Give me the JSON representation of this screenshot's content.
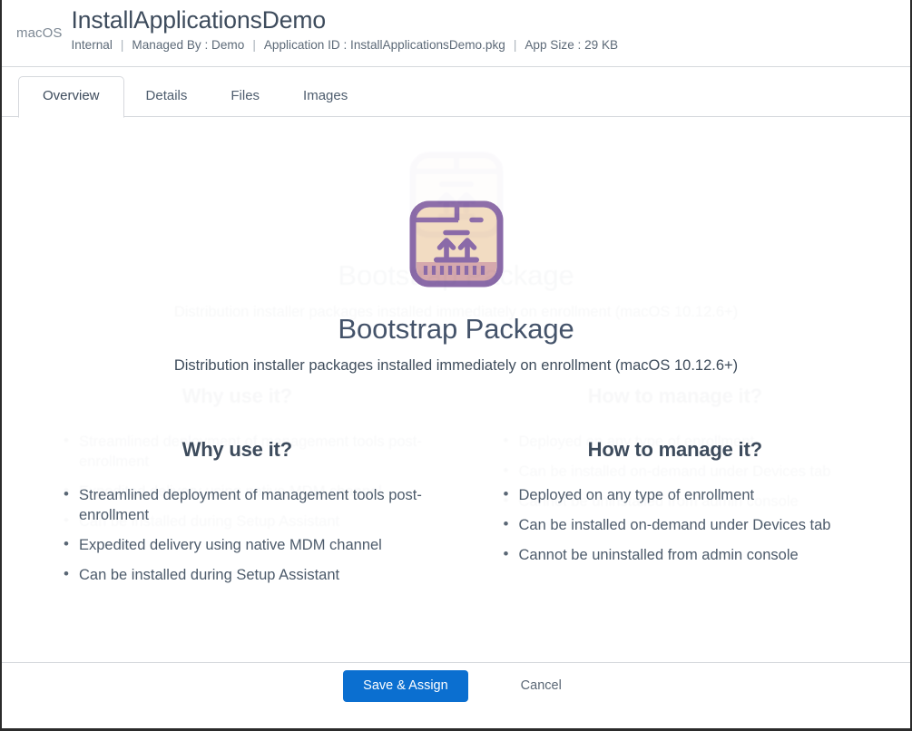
{
  "header": {
    "platform": "macOS",
    "title": "InstallApplicationsDemo",
    "meta": {
      "scope": "Internal",
      "managed_by": "Managed By : Demo",
      "application_id": "Application ID : InstallApplicationsDemo.pkg",
      "app_size": "App Size : 29 KB",
      "separator": "|"
    }
  },
  "tabs": [
    {
      "label": "Overview",
      "active": true
    },
    {
      "label": "Details",
      "active": false
    },
    {
      "label": "Files",
      "active": false
    },
    {
      "label": "Images",
      "active": false
    }
  ],
  "hero": {
    "icon": "package-box-icon",
    "title": "Bootstrap Package",
    "subtitle": "Distribution installer packages installed immediately on enrollment (macOS 10.12.6+)"
  },
  "columns": [
    {
      "title": "Why use it?",
      "bullets": [
        "Streamlined deployment of management tools post-enrollment",
        "Expedited delivery using native MDM channel",
        "Can be installed during Setup Assistant"
      ]
    },
    {
      "title": "How to manage it?",
      "bullets": [
        "Deployed on any type of enrollment",
        "Can be installed on-demand under Devices tab",
        "Cannot be uninstalled from admin console"
      ]
    }
  ],
  "footer": {
    "primary_label": "Save & Assign",
    "cancel_label": "Cancel"
  },
  "colors": {
    "primary_button": "#0b6fd0",
    "icon_outline": "#8a6aa8",
    "icon_fill": "#f2dcc2",
    "icon_band": "#d3a8a8",
    "text_dark": "#3d4b5c",
    "text_muted": "#5d6a78",
    "border": "#d6d9dd"
  }
}
